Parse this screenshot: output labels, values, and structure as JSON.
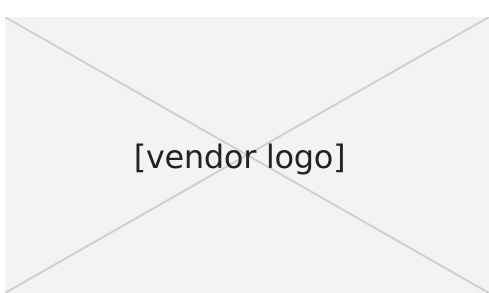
{
  "placeholder": {
    "label": "[vendor logo]",
    "background_color": "#f3f3f3",
    "line_color": "#cfcfcf",
    "text_color": "#222222",
    "icon": "image-placeholder-icon"
  }
}
